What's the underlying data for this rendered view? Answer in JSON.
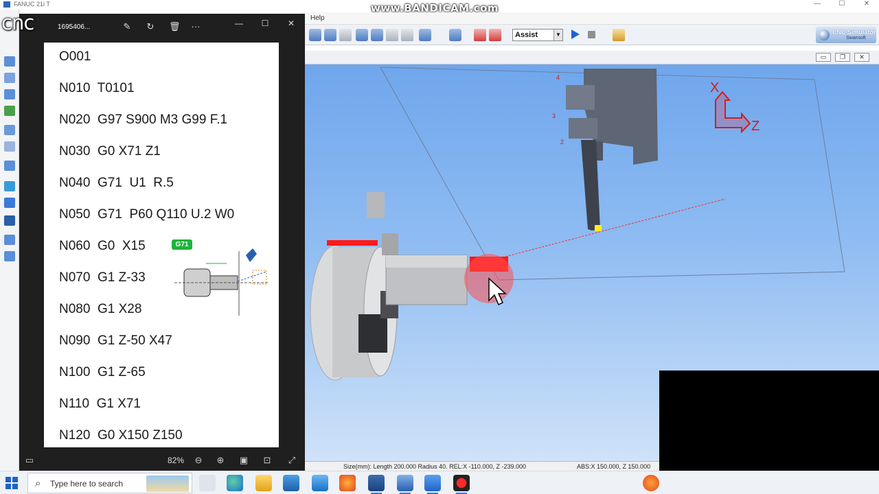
{
  "simulator": {
    "window_title": "FANUC 21i T",
    "menu_help": "Help",
    "mode_select": "Assist",
    "logo_title": "CNC Simulator",
    "logo_sub": "Swansoft",
    "axis_x": "X",
    "axis_z": "Z",
    "turret_numbers": [
      "4",
      "3",
      "2"
    ],
    "status_size": "Size(mm): Length 200.000 Radius  40. REL:X -110.000, Z -239.000",
    "status_abs": "ABS:X  150.000, Z  150.000"
  },
  "watermark": "www.BANDICAM.com",
  "overlay_label": "cnc",
  "viewer": {
    "filename": "1695406...",
    "zoom": "82%",
    "badge": "G71",
    "code_lines": [
      "O001",
      "N010  T0101",
      "N020  G97 S900 M3 G99 F.1",
      "N030  G0 X71 Z1",
      "N040  G71  U1  R.5",
      "N050  G71  P60 Q110 U.2 W0",
      "N060  G0  X15",
      "N070  G1 Z-33",
      "N080  G1 X28",
      "N090  G1 Z-50 X47",
      "N100  G1 Z-65",
      "N110  G1 X71",
      "N120  G0 X150 Z150"
    ]
  },
  "taskbar": {
    "search_placeholder": "Type here to search"
  },
  "colors": {
    "accent_blue": "#1c64d4",
    "cut_red": "#ff1a1a",
    "badge_green": "#1fb43a"
  }
}
